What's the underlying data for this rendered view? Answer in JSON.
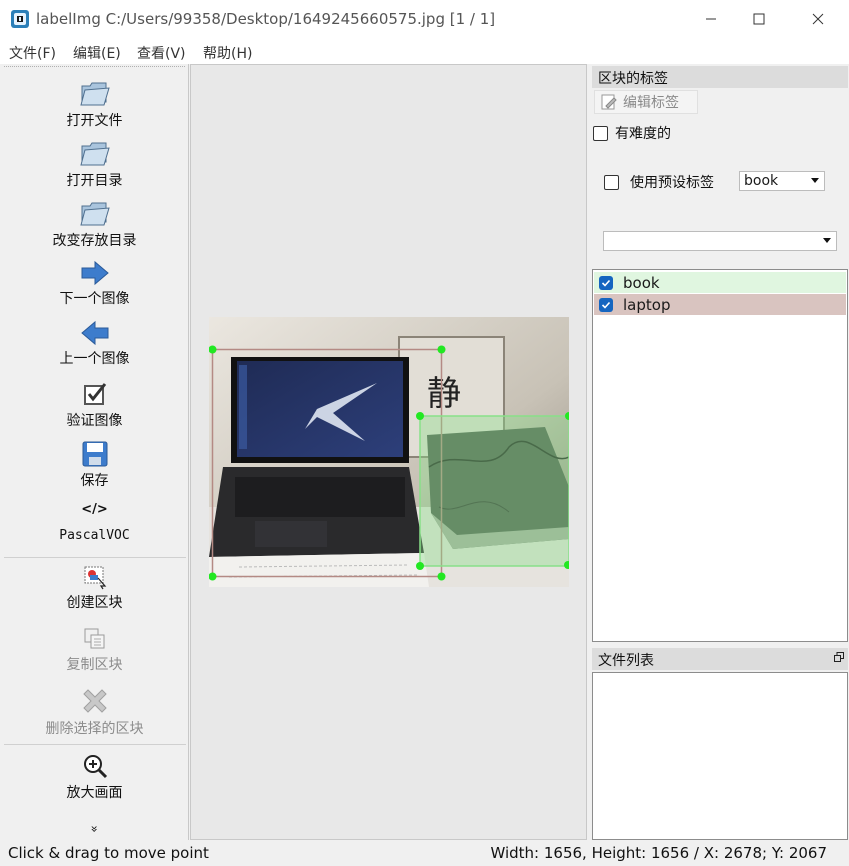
{
  "window": {
    "title": "labelImg C:/Users/99358/Desktop/1649245660575.jpg [1 / 1]"
  },
  "menu": {
    "file": "文件(F)",
    "edit": "编辑(E)",
    "view": "查看(V)",
    "help": "帮助(H)"
  },
  "toolbar": {
    "open_file": "打开文件",
    "open_dir": "打开目录",
    "change_save_dir": "改变存放目录",
    "next_image": "下一个图像",
    "prev_image": "上一个图像",
    "verify_image": "验证图像",
    "save": "保存",
    "format_icon": "</>",
    "format": "PascalVOC",
    "create_box": "创建区块",
    "duplicate_box": "复制区块",
    "delete_box": "删除选择的区块",
    "zoom_in": "放大画面",
    "more": "»"
  },
  "box_labels_panel": {
    "title": "区块的标签",
    "edit_label_button": "编辑标签",
    "difficult_label": "有难度的",
    "difficult_checked": false,
    "use_default_label": "使用预设标签",
    "use_default_checked": false,
    "default_label_value": "book",
    "second_combo_value": "",
    "labels": [
      {
        "text": "book",
        "checked": true,
        "color": "#e0f6e0"
      },
      {
        "text": "laptop",
        "checked": true,
        "color": "#d9c4c0"
      }
    ]
  },
  "file_list_panel": {
    "title": "文件列表"
  },
  "status": {
    "message": "Click & drag to move point",
    "info": "Width: 1656, Height: 1656 / X: 2678; Y: 2067"
  },
  "colors": {
    "handle": "#22e822",
    "laptop_box": "#b48a84",
    "book_box": "#88e088"
  }
}
